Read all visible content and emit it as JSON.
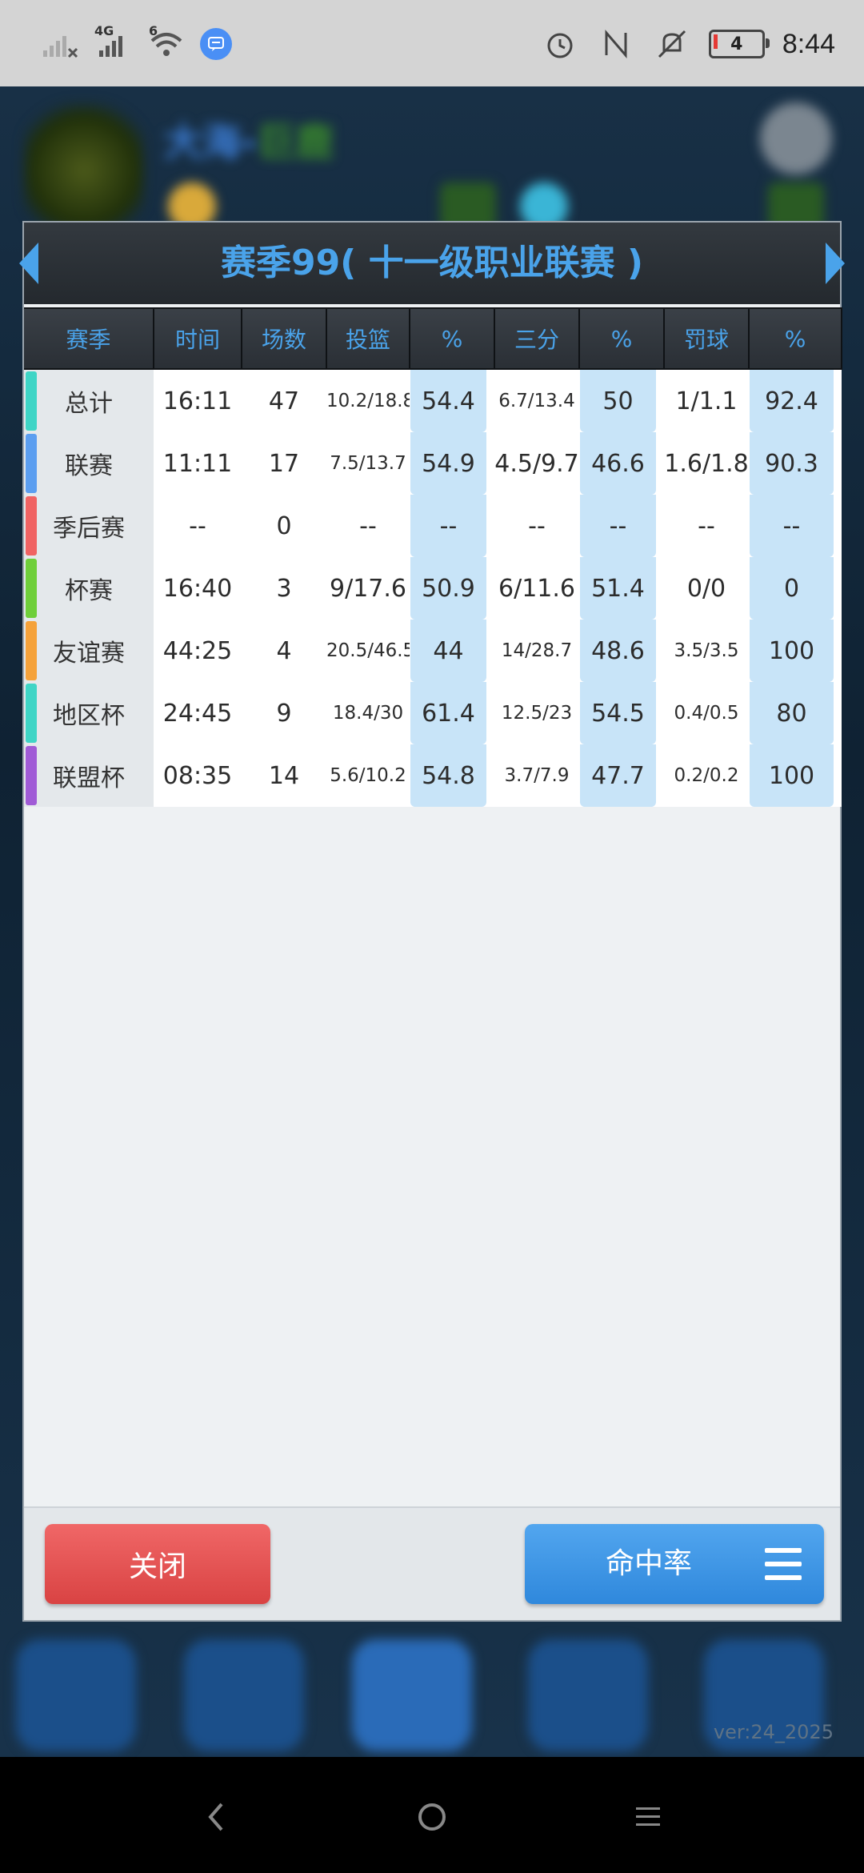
{
  "status_bar": {
    "time": "8:44",
    "battery_level": "4",
    "network_labels": [
      "4G",
      "6"
    ],
    "icons": [
      "signal-x-icon",
      "signal-4g-icon",
      "wifi-icon",
      "chat-badge-icon",
      "alarm-icon",
      "nfc-icon",
      "mute-icon",
      "battery-icon"
    ]
  },
  "background": {
    "team_name_a": "大海-",
    "team_name_b": "巨鹿",
    "version": "ver:24_2025"
  },
  "dialog": {
    "title": "赛季99( 十一级职业联赛 )",
    "columns": [
      "赛季",
      "时间",
      "场数",
      "投篮",
      "%",
      "三分",
      "%",
      "罚球",
      "%"
    ],
    "rows": [
      {
        "name": "总计",
        "stripe": "#3fd5c6",
        "time": "16:11",
        "games": "47",
        "fg": "10.2/18.8",
        "fg_pct": "54.4",
        "three": "6.7/13.4",
        "three_pct": "50",
        "ft": "1/1.1",
        "ft_pct": "92.4"
      },
      {
        "name": "联赛",
        "stripe": "#5b9ef0",
        "time": "11:11",
        "games": "17",
        "fg": "7.5/13.7",
        "fg_pct": "54.9",
        "three": "4.5/9.7",
        "three_pct": "46.6",
        "ft": "1.6/1.8",
        "ft_pct": "90.3"
      },
      {
        "name": "季后赛",
        "stripe": "#f06363",
        "time": "--",
        "games": "0",
        "fg": "--",
        "fg_pct": "--",
        "three": "--",
        "three_pct": "--",
        "ft": "--",
        "ft_pct": "--"
      },
      {
        "name": "杯赛",
        "stripe": "#6fcf3a",
        "time": "16:40",
        "games": "3",
        "fg": "9/17.6",
        "fg_pct": "50.9",
        "three": "6/11.6",
        "three_pct": "51.4",
        "ft": "0/0",
        "ft_pct": "0"
      },
      {
        "name": "友谊赛",
        "stripe": "#f5a23a",
        "time": "44:25",
        "games": "4",
        "fg": "20.5/46.5",
        "fg_pct": "44",
        "three": "14/28.7",
        "three_pct": "48.6",
        "ft": "3.5/3.5",
        "ft_pct": "100"
      },
      {
        "name": "地区杯",
        "stripe": "#3fd5c6",
        "time": "24:45",
        "games": "9",
        "fg": "18.4/30",
        "fg_pct": "61.4",
        "three": "12.5/23",
        "three_pct": "54.5",
        "ft": "0.4/0.5",
        "ft_pct": "80"
      },
      {
        "name": "联盟杯",
        "stripe": "#a05bd6",
        "time": "08:35",
        "games": "14",
        "fg": "5.6/10.2",
        "fg_pct": "54.8",
        "three": "3.7/7.9",
        "three_pct": "47.7",
        "ft": "0.2/0.2",
        "ft_pct": "100"
      }
    ],
    "close_label": "关闭",
    "rate_label": "命中率"
  }
}
